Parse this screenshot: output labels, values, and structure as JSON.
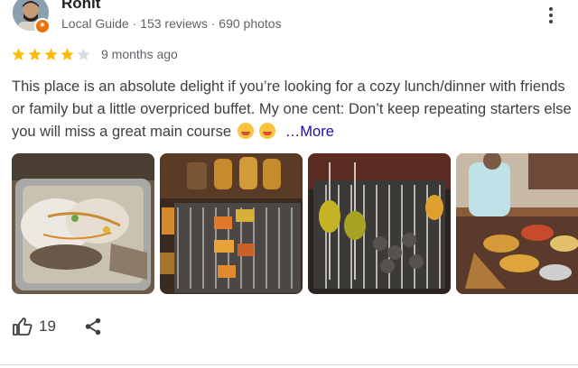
{
  "reviewer": {
    "name": "Rohit",
    "meta": "Local Guide · 153 reviews · 690 photos"
  },
  "rating": {
    "stars_filled": 4,
    "stars_total": 5,
    "time": "9 months ago",
    "star_color": "#fbbc04",
    "empty_star_color": "#dadce0"
  },
  "review": {
    "text": "This place is an absolute delight if you’re looking for a cozy lunch/dinner with friends or family but a little overpriced buffet. My one cent: Don’t keep repeating starters else you will miss a great main course",
    "more_label": "More",
    "more_prefix": "…"
  },
  "photos": [
    {
      "name": "photo-dessert"
    },
    {
      "name": "photo-grill-skewers"
    },
    {
      "name": "photo-barbecue-grill"
    },
    {
      "name": "photo-food-counter"
    }
  ],
  "actions": {
    "like_count": "19"
  },
  "icons": {
    "menu": "more-vert-icon",
    "like": "thumb-up-icon",
    "share": "share-icon"
  },
  "colors": {
    "link": "#1a0dab",
    "badge": "#e8710a"
  }
}
